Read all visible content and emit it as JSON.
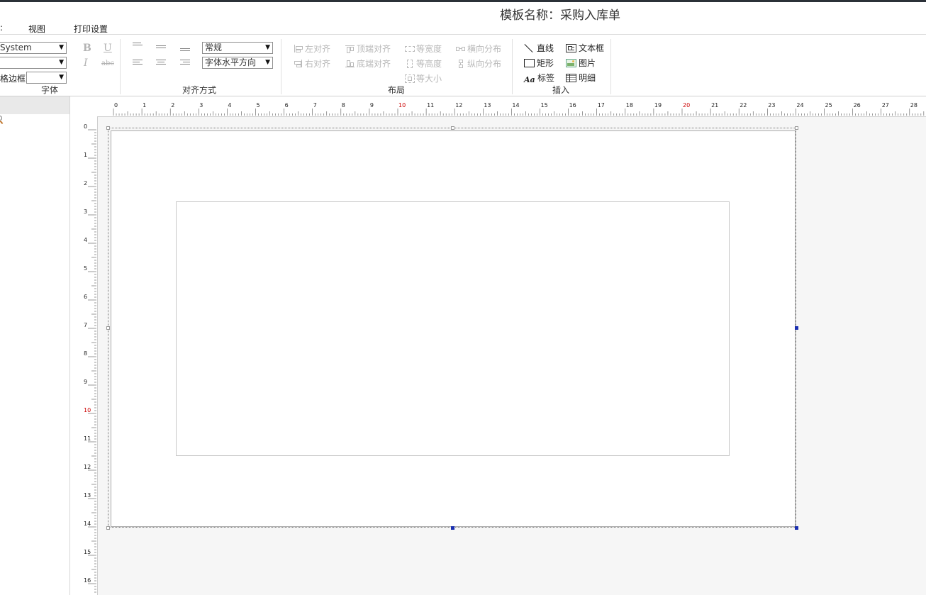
{
  "app": {
    "title": "模板名称：采购入库单"
  },
  "menu": {
    "items": [
      ":",
      "视图",
      "打印设置"
    ]
  },
  "ribbon": {
    "font_group": {
      "label": "字体",
      "font_name": "System",
      "font_size": "",
      "border_label": "格边框",
      "border_value": "",
      "bold": "B",
      "underline": "U",
      "italic": "I",
      "strike": "abc"
    },
    "align_group": {
      "label": "对齐方式",
      "style_value": "常规",
      "direction_value": "字体水平方向"
    },
    "layout_group": {
      "label": "布局",
      "align_left": "左对齐",
      "align_right": "右对齐",
      "align_top": "顶端对齐",
      "align_bottom": "底端对齐",
      "same_width": "等宽度",
      "same_height": "等高度",
      "same_size": "等大小",
      "dist_h": "横向分布",
      "dist_v": "纵向分布"
    },
    "insert_group": {
      "label": "插入",
      "line": "直线",
      "rect": "矩形",
      "label_btn": "标签",
      "textbox": "文本框",
      "image": "图片",
      "detail": "明细",
      "label_icon_text": "Aa"
    }
  },
  "ruler": {
    "h_labels": [
      "0",
      "1",
      "2",
      "3",
      "4",
      "5",
      "6",
      "7",
      "8",
      "9",
      "10",
      "11",
      "12",
      "13",
      "14",
      "15",
      "16",
      "17",
      "18",
      "19",
      "20",
      "21",
      "22",
      "23",
      "24",
      "25",
      "26",
      "27",
      "28"
    ],
    "v_labels": [
      "0",
      "1",
      "2",
      "3",
      "4",
      "5",
      "6",
      "7",
      "8",
      "9",
      "10",
      "11",
      "12",
      "13",
      "14",
      "15",
      "16"
    ],
    "highlight_labels": [
      "10",
      "20"
    ],
    "highlight_color": "#cc0000"
  },
  "colors": {
    "handle_selected": "#1a2fb0",
    "splitter": "#c5d1dd",
    "canvas_bg": "#f6f6f6"
  }
}
